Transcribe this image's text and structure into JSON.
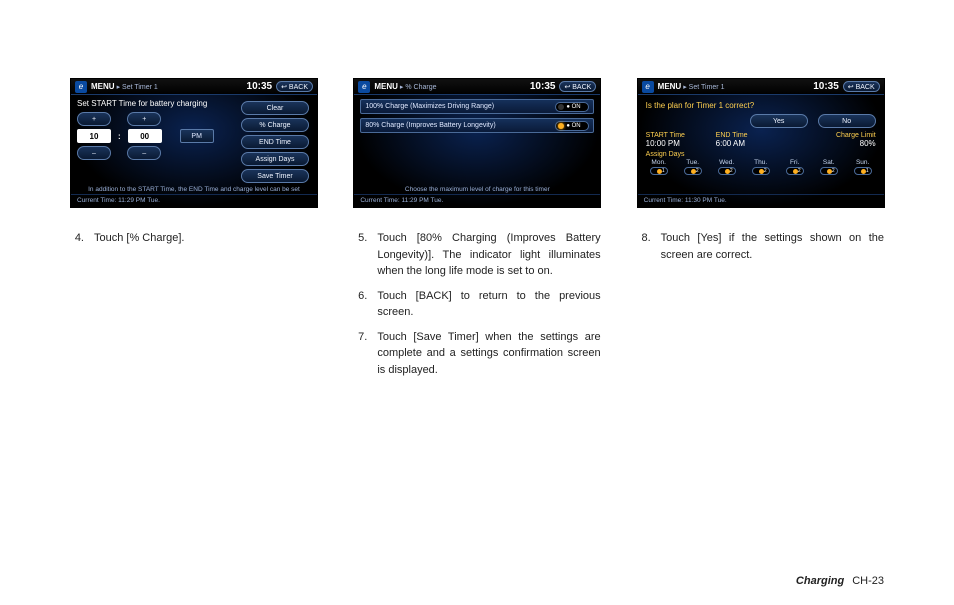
{
  "screens": {
    "s1": {
      "menu": "MENU",
      "crumb": "▸ Set Timer 1",
      "clock": "10:35",
      "back": "↩ BACK",
      "prompt": "Set START Time for battery charging",
      "plus": "+",
      "minus": "–",
      "hour": "10",
      "minute": "00",
      "ampm": "PM",
      "btn_clear": "Clear",
      "btn_pct": "% Charge",
      "btn_end": "END Time",
      "btn_assign": "Assign Days",
      "btn_save": "Save Timer",
      "current": "Current Time: 11:29 PM Tue.",
      "hint": "In addition to the START Time, the END Time and charge level can be set"
    },
    "s2": {
      "menu": "MENU",
      "crumb": "▸ % Charge",
      "clock": "10:35",
      "back": "↩ BACK",
      "row1": "100% Charge (Maximizes Driving Range)",
      "row1_state": "● ON",
      "row2": "80% Charge (Improves Battery Longevity)",
      "row2_state": "● ON",
      "current": "Current Time: 11:29 PM Tue.",
      "hint": "Choose the maximum level of charge for this timer"
    },
    "s3": {
      "menu": "MENU",
      "crumb": "▸ Set Timer 1",
      "clock": "10:35",
      "back": "↩ BACK",
      "question": "Is the plan for Timer 1 correct?",
      "yes": "Yes",
      "no": "No",
      "h_start": "START Time",
      "h_end": "END Time",
      "h_limit": "Charge Limit",
      "v_start": "10:00 PM",
      "v_end": "6:00 AM",
      "v_limit": "80%",
      "assign": "Assign Days",
      "days": [
        "Mon.",
        "Tue.",
        "Wed.",
        "Thu.",
        "Fri.",
        "Sat.",
        "Sun."
      ],
      "idx": [
        "1",
        "2",
        "2",
        "2",
        "2",
        "2",
        "1"
      ],
      "current": "Current Time: 11:30 PM Tue."
    }
  },
  "steps": {
    "c1": [
      {
        "n": "4.",
        "t": "Touch [% Charge]."
      }
    ],
    "c2": [
      {
        "n": "5.",
        "t": "Touch [80% Charging (Improves Battery Longevity)]. The indicator light illuminates when the long life mode is set to on."
      },
      {
        "n": "6.",
        "t": "Touch [BACK] to return to the previous screen."
      },
      {
        "n": "7.",
        "t": "Touch [Save Timer] when the settings are complete and a settings confirmation screen is displayed."
      }
    ],
    "c3": [
      {
        "n": "8.",
        "t": "Touch [Yes] if the settings shown on the screen are correct."
      }
    ]
  },
  "footer": {
    "section": "Charging",
    "page": "CH-23"
  }
}
